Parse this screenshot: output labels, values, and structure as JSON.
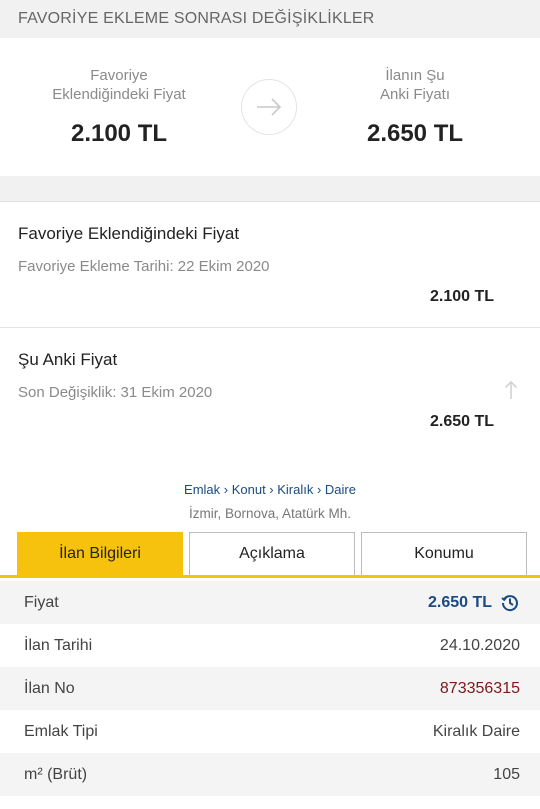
{
  "header": {
    "title": "FAVORİYE EKLEME SONRASI DEĞİŞİKLİKLER"
  },
  "compare": {
    "left_label_1": "Favoriye",
    "left_label_2": "Eklendiğindeki Fiyat",
    "left_price": "2.100 TL",
    "right_label_1": "İlanın Şu",
    "right_label_2": "Anki Fiyatı",
    "right_price": "2.650 TL",
    "arrow_icon": "arrow-right-icon"
  },
  "history": [
    {
      "title": "Favoriye Eklendiğindeki Fiyat",
      "subtitle": "Favoriye Ekleme Tarihi: 22 Ekim 2020",
      "price": "2.100 TL"
    },
    {
      "title": "Şu Anki Fiyat",
      "subtitle": "Son Değişiklik: 31 Ekim 2020",
      "price": "2.650 TL",
      "trend_icon": "arrow-up-icon"
    }
  ],
  "listing": {
    "breadcrumb": "Emlak › Konut › Kiralık › Daire",
    "location": "İzmir, Bornova, Atatürk Mh."
  },
  "tabs": [
    {
      "label": "İlan Bilgileri",
      "active": true
    },
    {
      "label": "Açıklama",
      "active": false
    },
    {
      "label": "Konumu",
      "active": false
    }
  ],
  "details": [
    {
      "label": "Fiyat",
      "value": "2.650 TL",
      "icon": "price-history-icon"
    },
    {
      "label": "İlan Tarihi",
      "value": "24.10.2020"
    },
    {
      "label": "İlan No",
      "value": "873356315"
    },
    {
      "label": "Emlak Tipi",
      "value": "Kiralık Daire"
    },
    {
      "label": "m² (Brüt)",
      "value": "105"
    }
  ],
  "colors": {
    "accent": "#f7c20e",
    "link": "#1a4a80",
    "ilan_no": "#7a1a1a"
  }
}
